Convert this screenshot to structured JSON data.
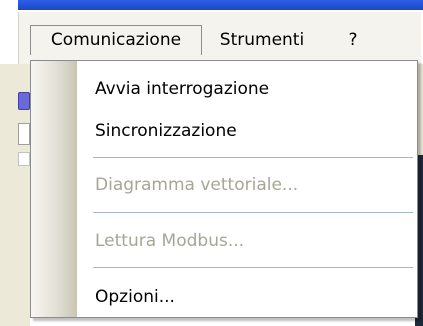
{
  "menubar": {
    "items": [
      {
        "label": "Comunicazione"
      },
      {
        "label": "Strumenti"
      },
      {
        "label": "?"
      }
    ]
  },
  "dropdown": {
    "items": [
      {
        "label": "Avvia interrogazione",
        "enabled": true
      },
      {
        "label": "Sincronizzazione",
        "enabled": true
      },
      {
        "label": "Diagramma vettoriale...",
        "enabled": false
      },
      {
        "label": "Lettura Modbus...",
        "enabled": false
      },
      {
        "label": "Opzioni...",
        "enabled": true
      }
    ]
  }
}
